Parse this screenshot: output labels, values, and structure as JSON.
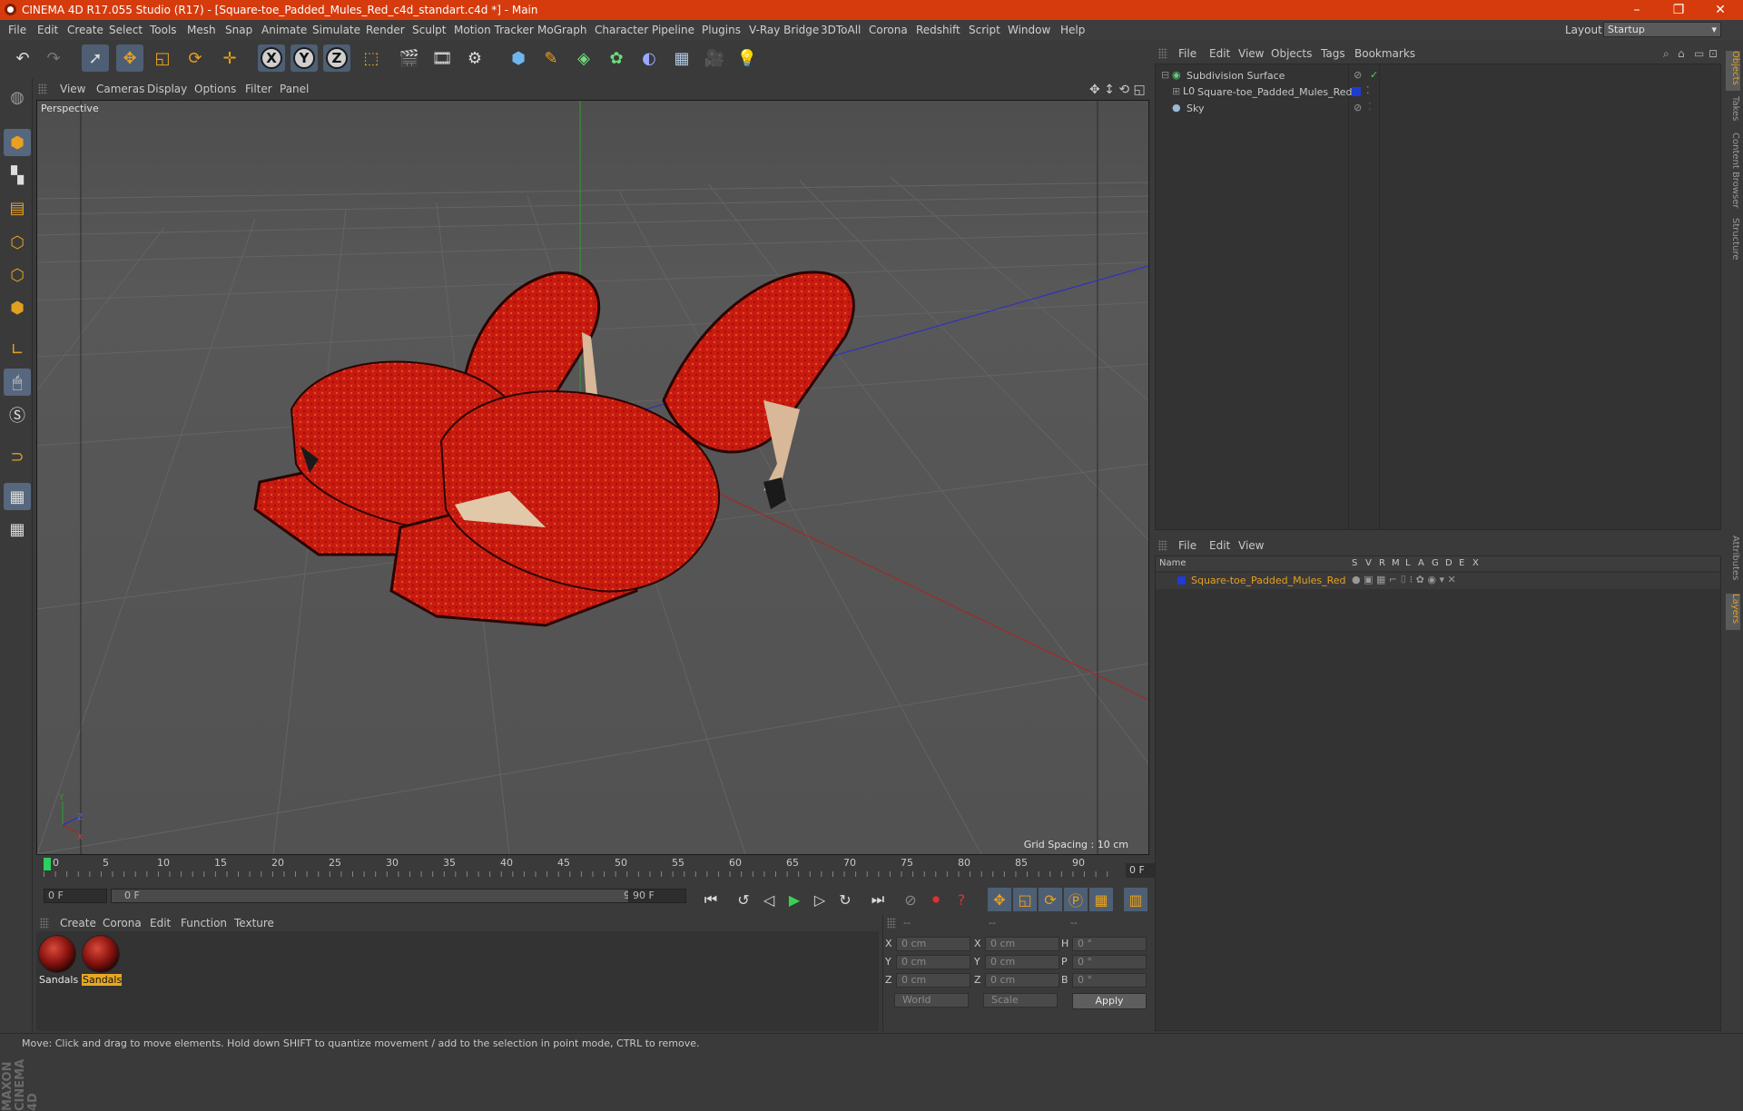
{
  "window": {
    "title": "CINEMA 4D R17.055 Studio (R17) - [Square-toe_Padded_Mules_Red_c4d_standart.c4d *] - Main",
    "controls": [
      "–",
      "❐",
      "✕"
    ]
  },
  "menubar": {
    "items": [
      "File",
      "Edit",
      "Create",
      "Select",
      "Tools",
      "Mesh",
      "Snap",
      "Animate",
      "Simulate",
      "Render",
      "Sculpt",
      "Motion Tracker",
      "MoGraph",
      "Character",
      "Pipeline",
      "Plugins",
      "V-Ray Bridge",
      "3DToAll",
      "Corona",
      "Redshift",
      "Script",
      "Window",
      "Help"
    ],
    "layout_label": "Layout:",
    "layout_value": "Startup"
  },
  "toolbar": {
    "icons": [
      "undo-icon",
      "redo-icon",
      "select-pointer-icon",
      "move-icon",
      "scale-icon",
      "rotate-icon",
      "last-tool-icon",
      "x-axis-icon",
      "y-axis-icon",
      "z-axis-icon",
      "world-coordinates-icon",
      "render-view-icon",
      "render-picture-viewer-icon",
      "render-settings-icon",
      "cube-icon",
      "pen-spline-icon",
      "subdivision-icon",
      "cloner-icon",
      "deformer-icon",
      "floor-icon",
      "camera-icon",
      "light-icon"
    ],
    "axis_labels": [
      "X",
      "Y",
      "Z"
    ]
  },
  "left_tools": {
    "icons": [
      "make-editable-icon",
      "model-mode-icon",
      "texture-mode-icon",
      "workplane-icon",
      "points-mode-icon",
      "edges-mode-icon",
      "polygons-mode-icon",
      "axis-mode-icon",
      "tweak-icon",
      "snap-icon",
      "magnet-icon",
      "lock-workplane-icon",
      "grid-snap-icon"
    ]
  },
  "viewport": {
    "menu": [
      "View",
      "Cameras",
      "Display",
      "Options",
      "Filter",
      "Panel"
    ],
    "label": "Perspective",
    "grid_spacing": "Grid Spacing : 10 cm",
    "axis_labels": [
      "Y",
      "Z",
      "X"
    ]
  },
  "timeline": {
    "ticks": [
      "0",
      "5",
      "10",
      "15",
      "20",
      "25",
      "30",
      "35",
      "40",
      "45",
      "50",
      "55",
      "60",
      "65",
      "70",
      "75",
      "80",
      "85",
      "90"
    ],
    "current_frame": "0 F",
    "start_field": "0 F",
    "range_start": "0 F",
    "range_end": "90 F",
    "end_field": "90 F"
  },
  "material_manager": {
    "menu": [
      "Create",
      "Corona",
      "Edit",
      "Function",
      "Texture"
    ],
    "materials": [
      {
        "name": "Sandals",
        "active": false
      },
      {
        "name": "Sandals",
        "active": true
      }
    ]
  },
  "coordinates": {
    "headers": [
      "--",
      "--",
      "--"
    ],
    "rows": [
      {
        "a": "X",
        "a_val": "0 cm",
        "b": "X",
        "b_val": "0 cm",
        "c": "H",
        "c_val": "0 °"
      },
      {
        "a": "Y",
        "a_val": "0 cm",
        "b": "Y",
        "b_val": "0 cm",
        "c": "P",
        "c_val": "0 °"
      },
      {
        "a": "Z",
        "a_val": "0 cm",
        "b": "Z",
        "b_val": "0 cm",
        "c": "B",
        "c_val": "0 °"
      }
    ],
    "mode": "World",
    "transform": "Scale",
    "apply": "Apply"
  },
  "object_manager": {
    "menu": [
      "File",
      "Edit",
      "View",
      "Objects",
      "Tags",
      "Bookmarks"
    ],
    "objects": [
      {
        "name": "Subdivision Surface",
        "color": "#9ad0a0"
      },
      {
        "name": "Square-toe_Padded_Mules_Red",
        "color": "#c8c8c8",
        "layer_color": "#1e3cd0"
      },
      {
        "name": "Sky",
        "color": "#c8c8c8"
      }
    ]
  },
  "layer_manager": {
    "menu": [
      "File",
      "Edit",
      "View"
    ],
    "columns": [
      "Name",
      "S",
      "V",
      "R",
      "M",
      "L",
      "A",
      "G",
      "D",
      "E",
      "X"
    ],
    "layers": [
      {
        "name": "Square-toe_Padded_Mules_Red",
        "color": "#1e3cd0",
        "text_color": "#e8a020"
      }
    ]
  },
  "right_tabs": [
    "Objects",
    "Takes",
    "Content Browser",
    "Structure",
    "Attributes",
    "Layers"
  ],
  "status": "Move: Click and drag to move elements. Hold down SHIFT to quantize movement / add to the selection in point mode, CTRL to remove.",
  "branding": "MAXON CINEMA 4D",
  "colors": {
    "title_bar": "#d63b0d",
    "accent": "#e8a020",
    "shoe_red": "#c81a10",
    "ui_dark": "#333333"
  }
}
